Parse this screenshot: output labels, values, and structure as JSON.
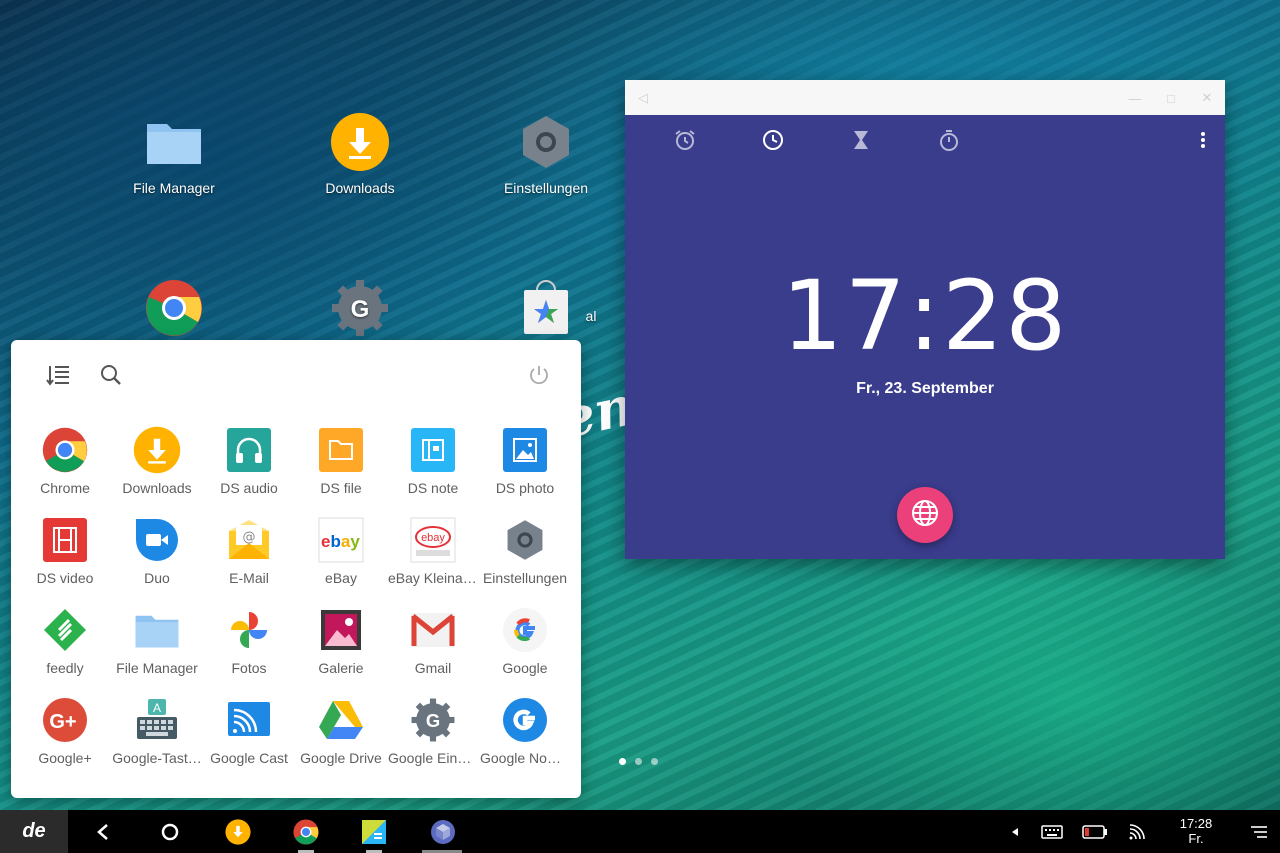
{
  "desktop": {
    "icons": [
      {
        "label": "File Manager",
        "icon": "folder-icon"
      },
      {
        "label": "Downloads",
        "icon": "download-icon"
      },
      {
        "label": "Einstellungen",
        "icon": "settings-hex-icon"
      },
      {
        "label": "",
        "icon": "chrome-icon"
      },
      {
        "label": "",
        "icon": "google-settings-icon"
      },
      {
        "label": "al",
        "icon": "play-store-bag-icon"
      }
    ],
    "wallpaper_text": "en",
    "page_dots": 3,
    "active_dot": 0
  },
  "drawer": {
    "apps": [
      {
        "label": "Chrome",
        "icon": "chrome-icon"
      },
      {
        "label": "Downloads",
        "icon": "download-icon"
      },
      {
        "label": "DS audio",
        "icon": "headphones-icon"
      },
      {
        "label": "DS file",
        "icon": "folder-outline-icon"
      },
      {
        "label": "DS note",
        "icon": "note-icon"
      },
      {
        "label": "DS photo",
        "icon": "photo-icon"
      },
      {
        "label": "DS video",
        "icon": "film-icon"
      },
      {
        "label": "Duo",
        "icon": "video-camera-icon"
      },
      {
        "label": "E-Mail",
        "icon": "email-envelope-icon"
      },
      {
        "label": "eBay",
        "icon": "ebay-icon"
      },
      {
        "label": "eBay Kleinan…",
        "icon": "ebay-kleinanzeigen-icon"
      },
      {
        "label": "Einstellungen",
        "icon": "settings-hex-icon"
      },
      {
        "label": "feedly",
        "icon": "feedly-icon"
      },
      {
        "label": "File Manager",
        "icon": "folder-icon"
      },
      {
        "label": "Fotos",
        "icon": "pinwheel-icon"
      },
      {
        "label": "Galerie",
        "icon": "gallery-icon"
      },
      {
        "label": "Gmail",
        "icon": "gmail-icon"
      },
      {
        "label": "Google",
        "icon": "google-g-icon"
      },
      {
        "label": "Google+",
        "icon": "google-plus-icon"
      },
      {
        "label": "Google-Tast…",
        "icon": "keyboard-icon"
      },
      {
        "label": "Google Cast",
        "icon": "cast-icon"
      },
      {
        "label": "Google Drive",
        "icon": "drive-icon"
      },
      {
        "label": "Google Einst…",
        "icon": "google-settings-icon"
      },
      {
        "label": "Google Now…",
        "icon": "google-now-icon"
      }
    ]
  },
  "clock": {
    "time": "17:28",
    "date": "Fr., 23. September",
    "tabs": [
      "alarm-icon",
      "clock-icon",
      "timer-icon",
      "stopwatch-icon"
    ],
    "active_tab": 1,
    "accent": "#3a3c8c",
    "fab_color": "#ec407a"
  },
  "taskbar": {
    "start_label": "de",
    "tray_time": "17:28",
    "tray_day": "Fr."
  },
  "colors": {
    "drawer_bg": "#ffffff",
    "label_gray": "#5f5f5f",
    "taskbar_bg": "#000000"
  }
}
